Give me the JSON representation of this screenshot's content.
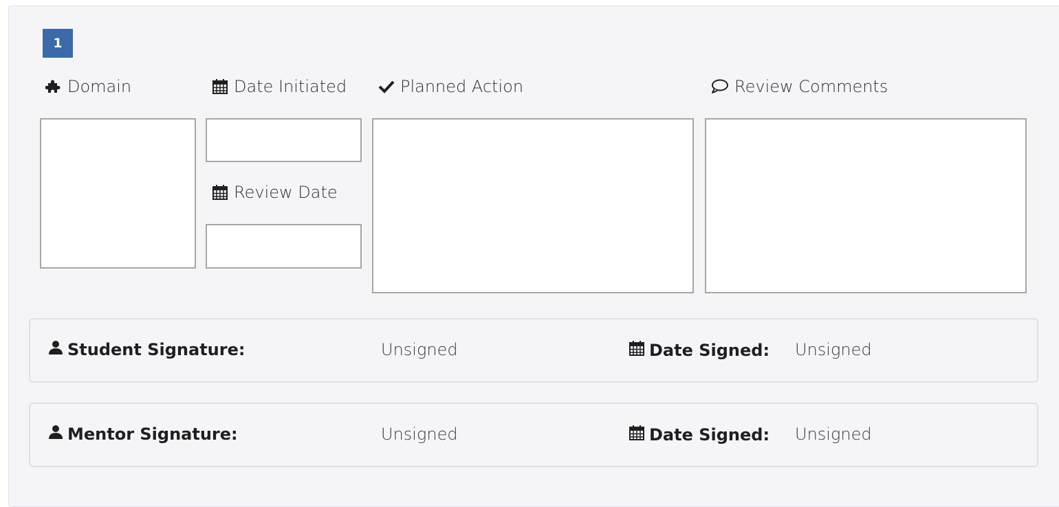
{
  "badge": "1",
  "columns": {
    "domain": {
      "label": "Domain",
      "icon": "puzzle-icon",
      "value": ""
    },
    "date_initiated": {
      "label": "Date Initiated",
      "icon": "calendar-icon",
      "value": ""
    },
    "review_date": {
      "label": "Review Date",
      "icon": "calendar-icon",
      "value": ""
    },
    "planned_action": {
      "label": "Planned Action",
      "icon": "check-icon",
      "value": ""
    },
    "review_comments": {
      "label": "Review Comments",
      "icon": "comment-icon",
      "value": ""
    }
  },
  "signatures": [
    {
      "label": "Student Signature:",
      "icon": "user-icon",
      "value": "Unsigned",
      "date_label": "Date Signed:",
      "date_icon": "calendar-icon",
      "date_value": "Unsigned"
    },
    {
      "label": "Mentor Signature:",
      "icon": "user-icon",
      "value": "Unsigned",
      "date_label": "Date Signed:",
      "date_icon": "calendar-icon",
      "date_value": "Unsigned"
    }
  ],
  "colors": {
    "badge": "#3a6aa8",
    "panel": "#f5f5f8",
    "border": "#a6a6a6"
  }
}
